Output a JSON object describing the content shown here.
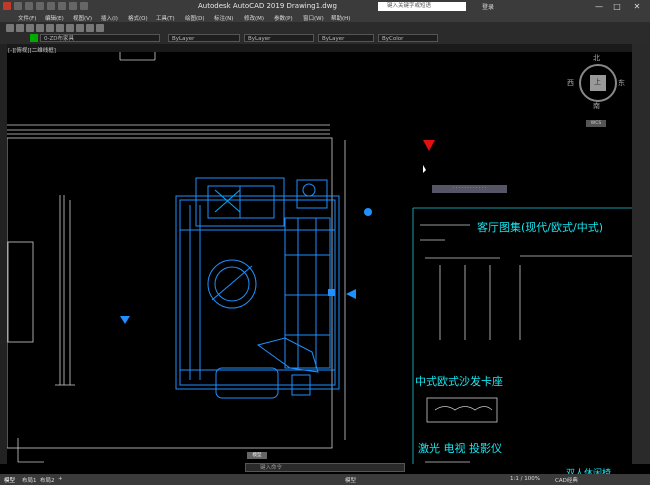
{
  "titlebar": {
    "title": "Autodesk AutoCAD 2019    Drawing1.dwg",
    "search_placeholder": "键入关键字或短语",
    "login": "登录",
    "min": "—",
    "max": "□",
    "close": "✕"
  },
  "menubar": {
    "items": [
      "文件(F)",
      "编辑(E)",
      "视图(V)",
      "插入(I)",
      "格式(O)",
      "工具(T)",
      "绘图(D)",
      "标注(N)",
      "修改(M)",
      "参数(P)",
      "窗口(W)",
      "帮助(H)"
    ]
  },
  "properties": {
    "layer": "0-ZD布家具",
    "color": "ByLayer",
    "linetype": "ByLayer",
    "lineweight": "ByLayer",
    "plotstyle": "ByColor"
  },
  "viewport": {
    "label": "[-][俯视][二维线框]"
  },
  "viewcube": {
    "north": "北",
    "south": "南",
    "east": "东",
    "west": "西",
    "top": "上",
    "wcs": "WCS"
  },
  "drawing": {
    "title_living": "客厅图集(现代/欧式/中式)",
    "title_sofa": "中式欧式沙发卡座",
    "title_tv": "激光 电视 投影仪",
    "title_partial": "双人休闲椅",
    "tooltip_bar": "· · · · · · · · · · · ·"
  },
  "command": {
    "placeholder": "键入命令",
    "tag": "模型"
  },
  "statusbar": {
    "tab_model": "模型",
    "tab_layout1": "布局1",
    "tab_layout2": "布局2",
    "add": "+",
    "scale": "1:1 / 100%",
    "workspace": "CAD经典"
  }
}
